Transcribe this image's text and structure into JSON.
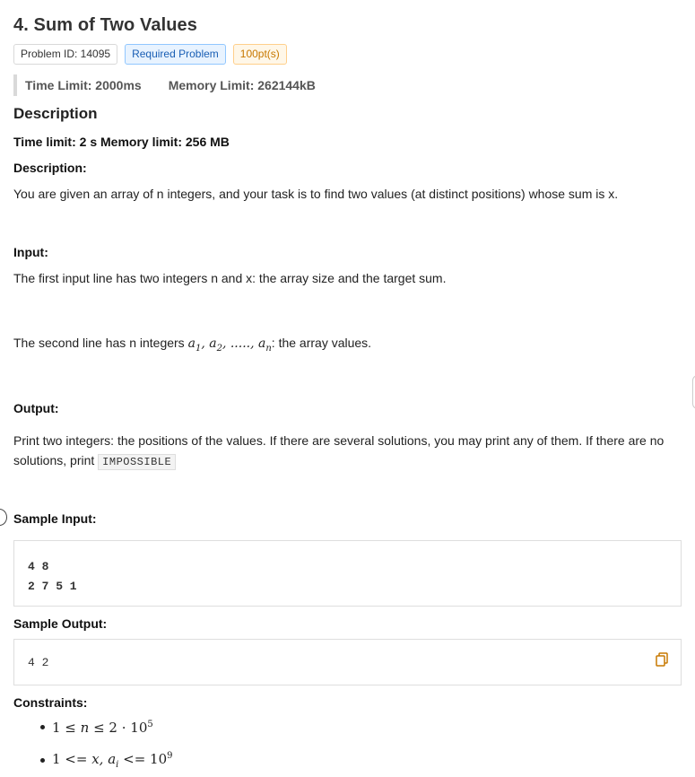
{
  "problem": {
    "title": "4. Sum of Two Values",
    "tags": {
      "problem_id": "Problem ID: 14095",
      "required": "Required Problem",
      "points": "100pt(s)"
    },
    "time_limit": "Time Limit: 2000ms",
    "memory_limit": "Memory Limit: 262144kB"
  },
  "description": {
    "heading": "Description",
    "limits_line": "Time limit: 2 s Memory limit: 256 MB",
    "desc_label": "Description:",
    "desc_text": "You are given an array of n integers, and your task is to find two values (at distinct positions) whose sum is x.",
    "input_label": "Input:",
    "input_line1": "The first input line has two integers n and x: the array size and the target sum.",
    "input_line2_prefix": "The second line has n integers ",
    "input_line2_math": "a1, a2, ....., an",
    "input_line2_suffix": ": the array values.",
    "output_label": "Output:",
    "output_text": "Print two integers: the positions of the values. If there are several solutions, you may print any of them. If there are no solutions, print ",
    "output_code": "IMPOSSIBLE"
  },
  "samples": {
    "input_label": "Sample Input:",
    "input_lines": [
      "4 8",
      "2 7 5 1"
    ],
    "output_label": "Sample Output:",
    "output_lines": [
      "4 2"
    ]
  },
  "constraints": {
    "label": "Constraints:",
    "items": [
      "1 ≤ n ≤ 2 · 10^5",
      "1 <= x, a_i <= 10^9"
    ]
  },
  "icons": {
    "copy": "copy-icon",
    "side": "expand-circle-icon"
  },
  "colors": {
    "tag_blue": "#1a5fb4",
    "tag_orange": "#c77800",
    "copy_icon": "#c77800"
  }
}
